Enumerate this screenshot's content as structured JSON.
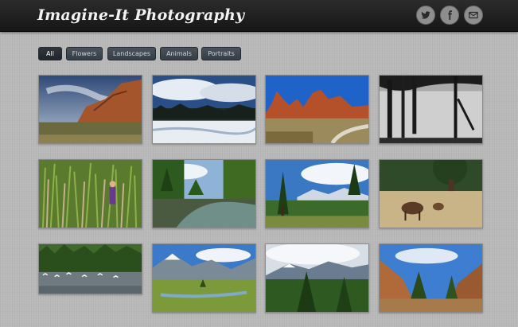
{
  "header": {
    "site_title": "Imagine-It Photography",
    "social_icons": [
      {
        "name": "twitter-icon"
      },
      {
        "name": "facebook-icon"
      },
      {
        "name": "email-icon"
      }
    ]
  },
  "filters": [
    {
      "label": "All",
      "active": true
    },
    {
      "label": "Flowers",
      "active": false
    },
    {
      "label": "Landscapes",
      "active": false
    },
    {
      "label": "Animals",
      "active": false
    },
    {
      "label": "Portraits",
      "active": false
    }
  ],
  "gallery": {
    "photos": [
      {
        "subject": "red rock cliff with cloudy sky"
      },
      {
        "subject": "snowy field under dramatic clouds"
      },
      {
        "subject": "red rock formations with blue sky"
      },
      {
        "subject": "dark tree silhouettes by lake"
      },
      {
        "subject": "child in tall green grass"
      },
      {
        "subject": "stream through green forest"
      },
      {
        "subject": "pine trees and mountain meadow"
      },
      {
        "subject": "elk grazing under tree"
      },
      {
        "subject": "birds over river with forest"
      },
      {
        "subject": "mountain valley with river"
      },
      {
        "subject": "snowy peaks above pine forest"
      },
      {
        "subject": "rocky canyon with pine trees"
      }
    ]
  },
  "colors": {
    "header_bg": "#1d1d1d",
    "page_bg": "#b9b9b9",
    "button_bg": "#3f474f",
    "social_icon_bg": "#8e8e8e"
  }
}
